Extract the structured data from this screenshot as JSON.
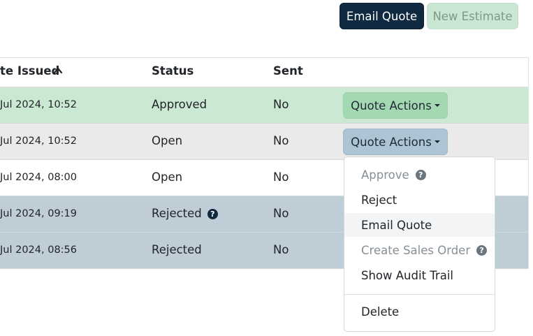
{
  "toolbar": {
    "email_quote": "Email Quote",
    "new_estimate": "New Estimate"
  },
  "table": {
    "headers": {
      "date_issued": "te Issued",
      "status": "Status",
      "sent": "Sent"
    },
    "sort": {
      "column": "date_issued",
      "direction": "ascending",
      "icon": "chevron-up-icon"
    },
    "rows": [
      {
        "date": "Jul 2024, 10:52",
        "status": "Approved",
        "sent": "No",
        "action": "Quote Actions",
        "bg": "#cbe8d3"
      },
      {
        "date": "Jul 2024, 10:52",
        "status": "Open",
        "sent": "No",
        "action": "Quote Actions",
        "bg": "#eaeaea"
      },
      {
        "date": "Jul 2024, 08:00",
        "status": "Open",
        "sent": "No",
        "bg": "#ffffff"
      },
      {
        "date": "Jul 2024, 09:19",
        "status": "Rejected",
        "sent": "No",
        "help": "?",
        "bg": "#bfcdd7"
      },
      {
        "date": "Jul 2024, 08:56",
        "status": "Rejected",
        "sent": "No",
        "bg": "#bfcdd7"
      }
    ]
  },
  "menu": {
    "items": [
      {
        "label": "Approve",
        "disabled": true,
        "help": "?"
      },
      {
        "label": "Reject",
        "disabled": false
      },
      {
        "label": "Email Quote",
        "disabled": false,
        "highlighted": true
      },
      {
        "label": "Create Sales Order",
        "disabled": true,
        "help": "?"
      },
      {
        "label": "Show Audit Trail",
        "disabled": false
      },
      {
        "label": "Delete",
        "disabled": false
      }
    ]
  },
  "colors": {
    "primary": "#0f2a40",
    "approved_row": "#cbe8d3",
    "rejected_row": "#bfcdd7",
    "selected_row": "#eaeaea"
  }
}
